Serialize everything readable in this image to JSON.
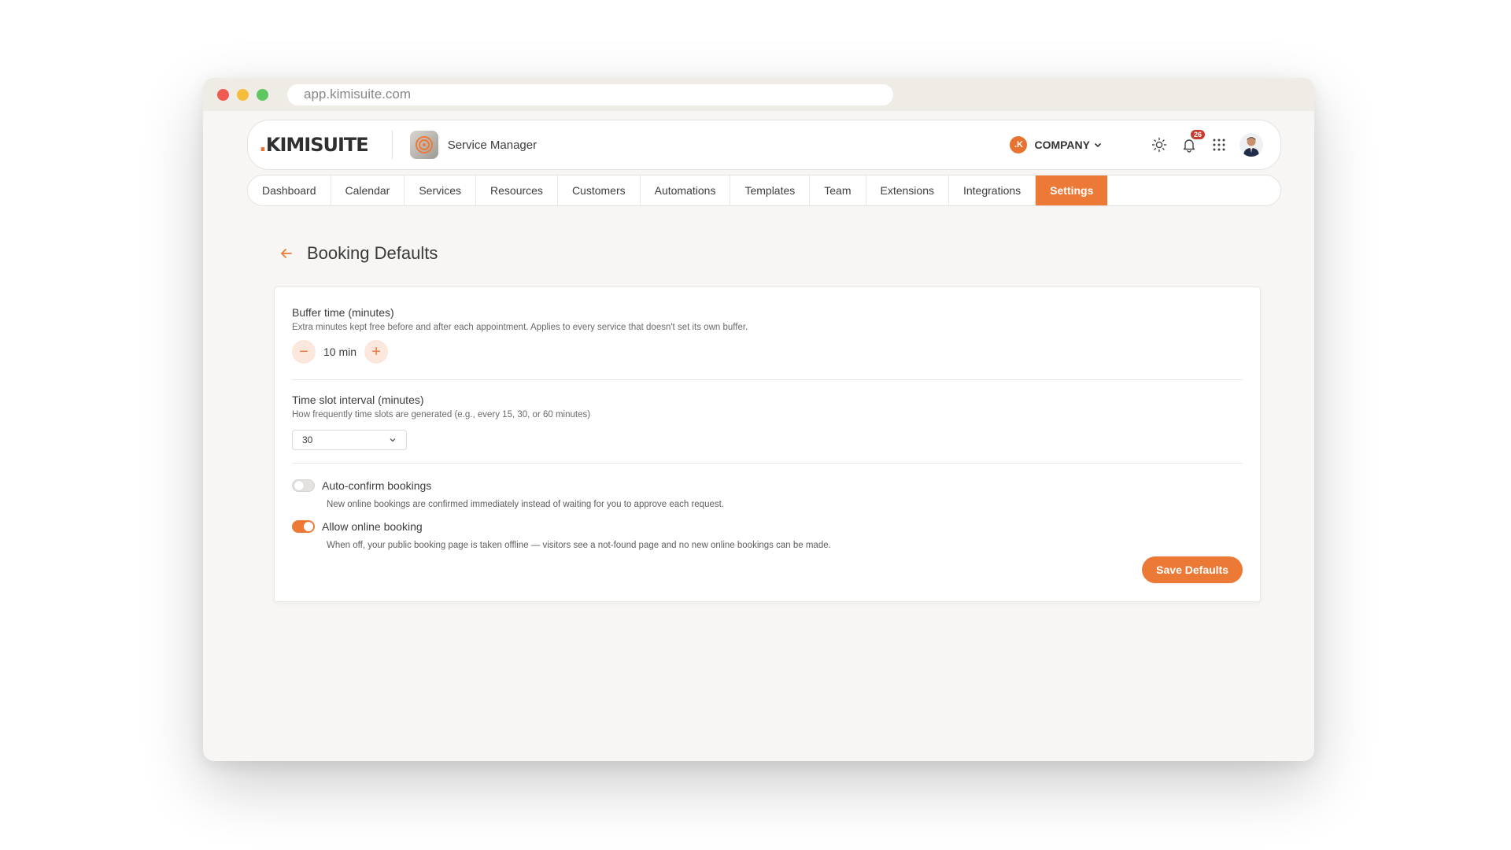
{
  "browser": {
    "url": "app.kimisuite.com"
  },
  "header": {
    "logo_dot": ".",
    "logo_text": "KIMISUITE",
    "app_name": "Service Manager",
    "company_initial": ".K",
    "company_label": "COMPANY",
    "notification_count": "26",
    "icons": [
      "sun-icon",
      "bell-icon",
      "apps-grid-icon",
      "avatar"
    ]
  },
  "nav": {
    "tabs": [
      {
        "label": "Dashboard",
        "active": false
      },
      {
        "label": "Calendar",
        "active": false
      },
      {
        "label": "Services",
        "active": false
      },
      {
        "label": "Resources",
        "active": false
      },
      {
        "label": "Customers",
        "active": false
      },
      {
        "label": "Automations",
        "active": false
      },
      {
        "label": "Templates",
        "active": false
      },
      {
        "label": "Team",
        "active": false
      },
      {
        "label": "Extensions",
        "active": false
      },
      {
        "label": "Integrations",
        "active": false
      },
      {
        "label": "Settings",
        "active": true
      }
    ]
  },
  "page": {
    "title": "Booking Defaults"
  },
  "form": {
    "buffer": {
      "label": "Buffer time (minutes)",
      "description": "Extra minutes kept free before and after each appointment. Applies to every service that doesn't set its own buffer.",
      "value": "10 min",
      "decrement": "−",
      "increment": "+"
    },
    "interval": {
      "label": "Time slot interval (minutes)",
      "description": "How frequently time slots are generated (e.g., every 15, 30, or 60 minutes)",
      "selected": "30"
    },
    "auto_confirm": {
      "label": "Auto-confirm bookings",
      "description": "New online bookings are confirmed immediately instead of waiting for you to approve each request.",
      "enabled": false
    },
    "online_booking": {
      "label": "Allow online booking",
      "description": "When off, your public booking page is taken offline — visitors see a not-found page and no new online bookings can be made.",
      "enabled": true
    },
    "save_label": "Save Defaults"
  },
  "colors": {
    "accent": "#ec7a36",
    "page_bg": "#f7f6f4",
    "notification": "#c93a2f"
  }
}
